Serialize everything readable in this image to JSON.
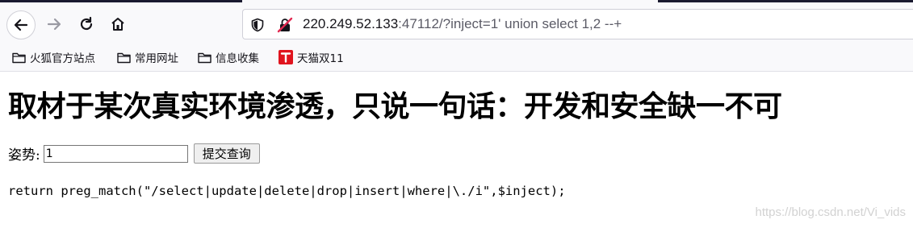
{
  "browser": {
    "url_host": "220.249.52.133",
    "url_rest": ":47112/?inject=1' union select 1,2 --+",
    "bookmarks": [
      {
        "label": "火狐官方站点",
        "icon": "folder-icon"
      },
      {
        "label": "常用网址",
        "icon": "folder-icon"
      },
      {
        "label": "信息收集",
        "icon": "folder-icon"
      },
      {
        "label": "天猫双11",
        "icon": "tmall-icon"
      }
    ],
    "colors": {
      "tmall": "#e0141e",
      "insecure": "#e22850"
    }
  },
  "page": {
    "heading": "取材于某次真实环境渗透，只说一句话：开发和安全缺一不可",
    "form": {
      "label": "姿势:",
      "input_value": "1",
      "submit_label": "提交查询"
    },
    "code_line": "return preg_match(\"/select|update|delete|drop|insert|where|\\./i\",$inject);",
    "watermark": "https://blog.csdn.net/Vi_vids"
  }
}
